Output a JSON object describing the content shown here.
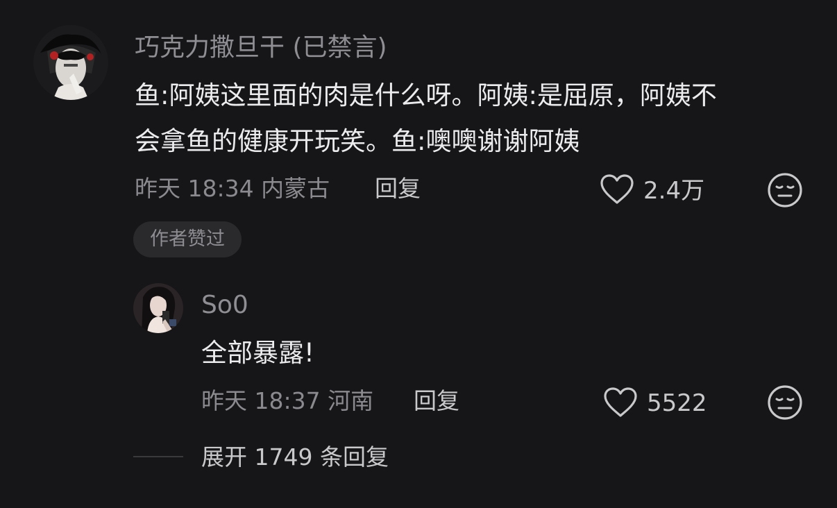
{
  "comment": {
    "author": "巧克力撒旦干 (已禁言)",
    "text_line1": "鱼:阿姨这里面的肉是什么呀。阿姨:是屈原，阿姨不",
    "text_line2": "会拿鱼的健康开玩笑。鱼:噢噢谢谢阿姨",
    "meta": "昨天 18:34 内蒙古",
    "reply_label": "回复",
    "likes": "2.4万",
    "author_liked_badge": "作者赞过"
  },
  "reply": {
    "author": "So0",
    "text": "全部暴露!",
    "meta": "昨天 18:37 河南",
    "reply_label": "回复",
    "likes": "5522"
  },
  "expand": {
    "label": "展开 1749 条回复"
  },
  "icons": {
    "like": "heart-outline-icon",
    "dislike": "meh-face-icon"
  },
  "colors": {
    "background": "#161618",
    "name": "#8e8e93",
    "text": "#ececee",
    "meta": "#8a8a8f",
    "badge_bg": "#2a2a2d"
  }
}
